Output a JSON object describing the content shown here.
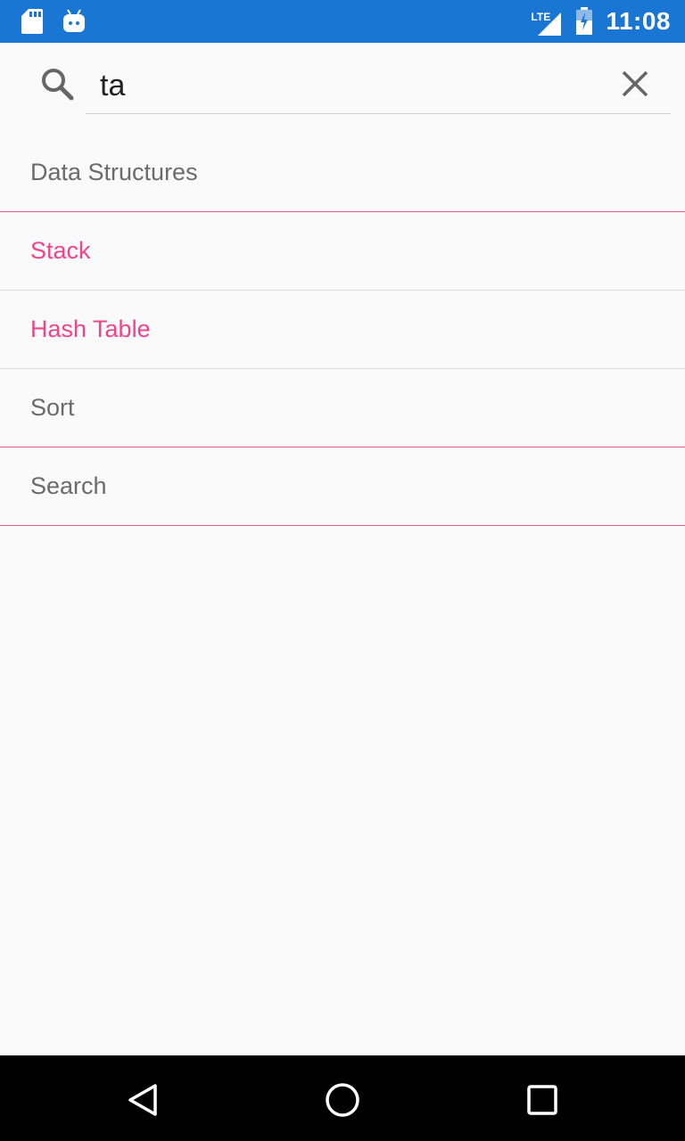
{
  "status_bar": {
    "time": "11:08",
    "network": "LTE",
    "background_color": "#1976d2",
    "icons": [
      "sd-card-icon",
      "android-icon",
      "signal-icon",
      "battery-icon"
    ]
  },
  "search": {
    "value": "ta",
    "icon": "search-icon",
    "clear_icon": "close-icon"
  },
  "results": [
    {
      "label": "Data Structures",
      "highlighted": false
    },
    {
      "label": "Stack",
      "highlighted": true
    },
    {
      "label": "Hash Table",
      "highlighted": true
    },
    {
      "label": "Sort",
      "highlighted": false
    },
    {
      "label": "Search",
      "highlighted": false
    }
  ],
  "colors": {
    "accent": "#f0448a",
    "text": "#6b6b6b"
  },
  "nav_bar": {
    "buttons": [
      "back-icon",
      "home-icon",
      "recents-icon"
    ]
  }
}
